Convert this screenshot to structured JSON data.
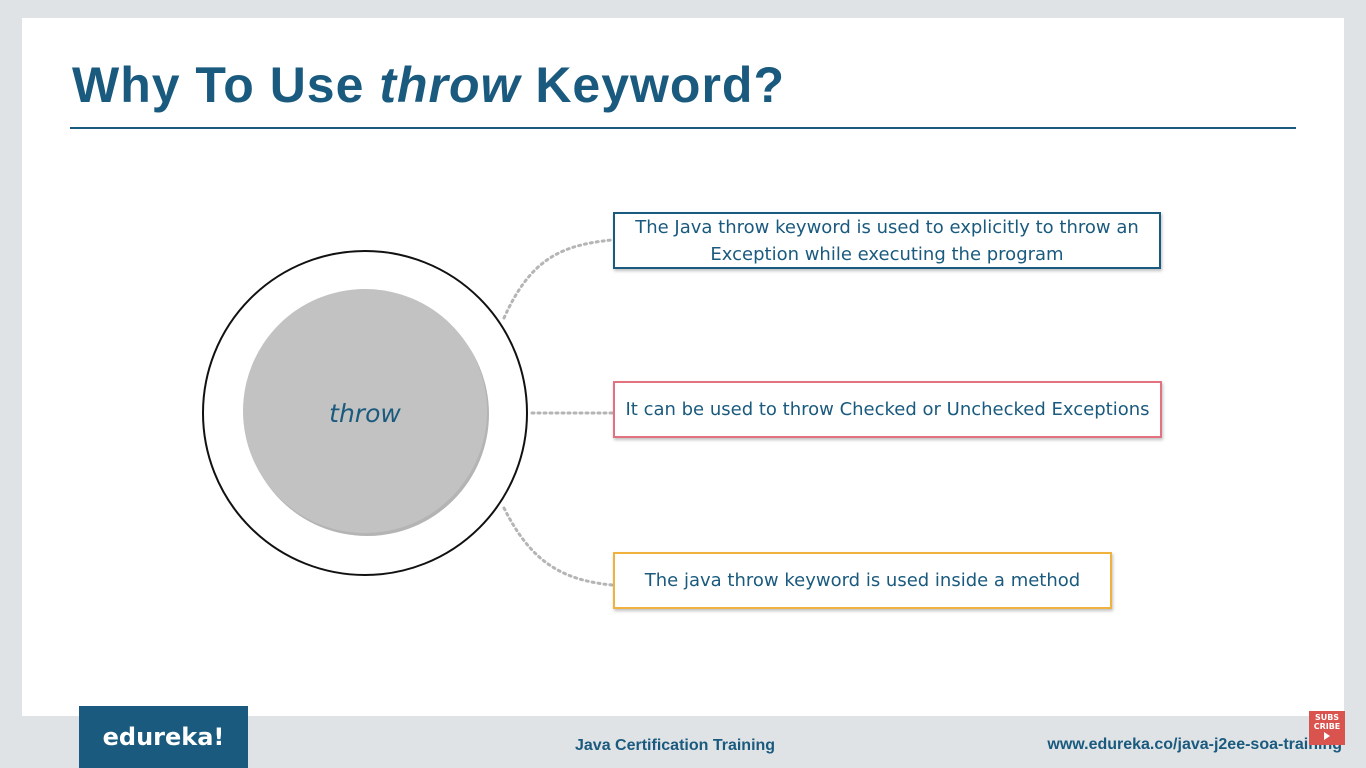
{
  "slide": {
    "title_prefix": "Why To Use ",
    "title_keyword": "throw",
    "title_suffix": " Keyword?",
    "center_label": "throw",
    "points": [
      "The Java throw keyword is used to explicitly to throw an Exception while executing the program",
      "It can be used to throw Checked or Unchecked Exceptions",
      "The java throw keyword is used inside a method"
    ]
  },
  "footer": {
    "logo_text": "edureka!",
    "course": "Java Certification Training",
    "url": "www.edureka.co/java-j2ee-soa-training",
    "subscribe_line1": "SUBS",
    "subscribe_line2": "CRIBE"
  },
  "colors": {
    "brand": "#1a5a7e",
    "point1_border": "#1a5a7e",
    "point2_border": "#e2727f",
    "point3_border": "#f0b23c",
    "circle_fill": "#c2c2c2",
    "subscribe_bg": "#d9534f"
  },
  "icons": {
    "subscribe": "youtube-subscribe-icon"
  }
}
